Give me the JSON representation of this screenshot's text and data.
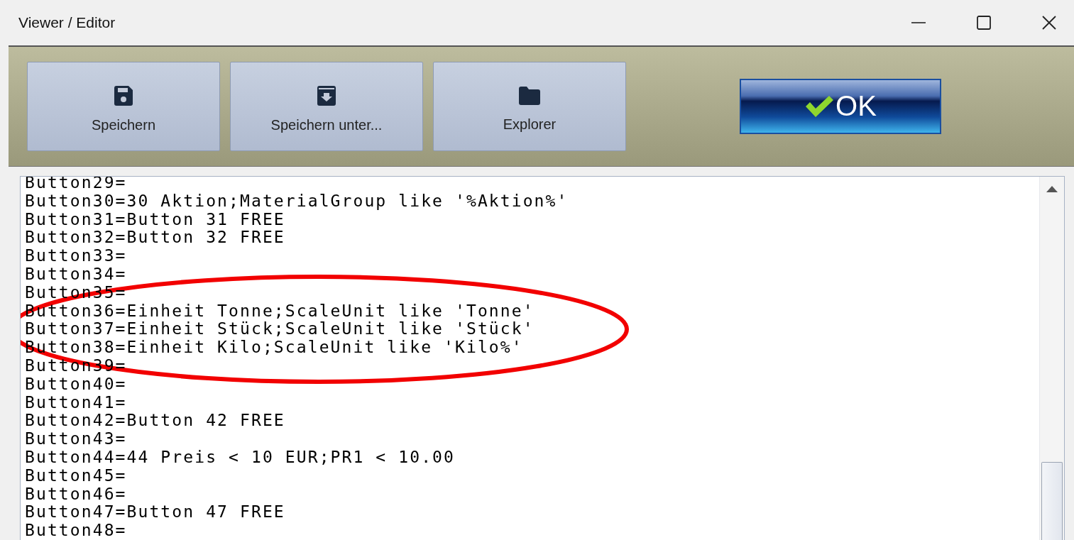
{
  "window": {
    "title": "Viewer / Editor"
  },
  "toolbar": {
    "buttons": [
      {
        "label": "Speichern"
      },
      {
        "label": "Speichern unter..."
      },
      {
        "label": "Explorer"
      }
    ],
    "ok_button": {
      "label": "OK"
    }
  },
  "editor": {
    "lines": [
      "Button29=",
      "Button30=30 Aktion;MaterialGroup like '%Aktion%'",
      "Button31=Button 31 FREE",
      "Button32=Button 32 FREE",
      "Button33=",
      "Button34=",
      "Button35=",
      "Button36=Einheit Tonne;ScaleUnit like 'Tonne'",
      "Button37=Einheit Stück;ScaleUnit like 'Stück'",
      "Button38=Einheit Kilo;ScaleUnit like 'Kilo%'",
      "Button39=",
      "Button40=",
      "Button41=",
      "Button42=Button 42 FREE",
      "Button43=",
      "Button44=44 Preis < 10 EUR;PR1 < 10.00",
      "Button45=",
      "Button46=",
      "Button47=Button 47 FREE",
      "Button48="
    ]
  }
}
